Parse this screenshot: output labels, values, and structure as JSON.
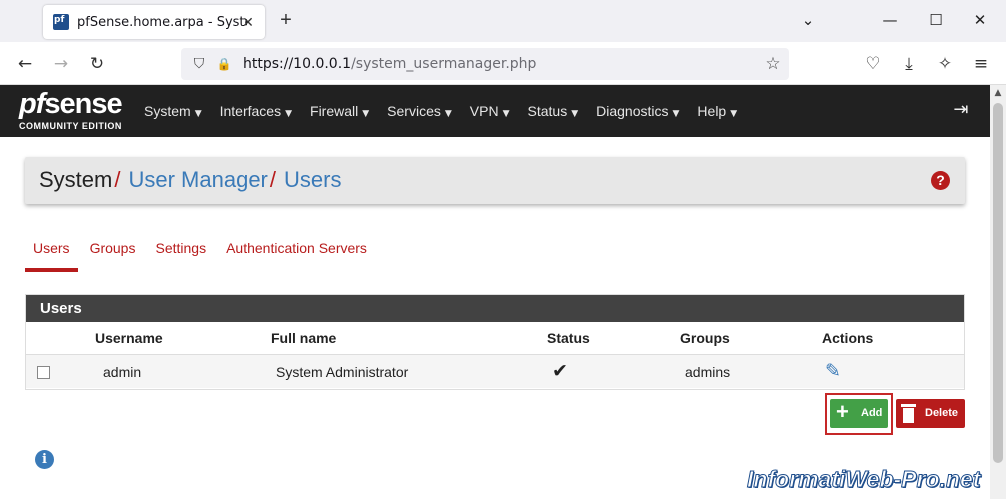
{
  "browser": {
    "tab_title": "pfSense.home.arpa - System: U",
    "tab_close": "✕",
    "new_tab": "+",
    "url_origin": "https://10.0.0.1",
    "url_path": "/system_usermanager.php",
    "icons": {
      "back": "←",
      "forward": "→",
      "reload": "↻",
      "shield": "⛉",
      "lock": "🔒",
      "star": "☆",
      "pocket": "♡",
      "download": "⤓",
      "extensions": "✧",
      "menu": "≡",
      "tabs_list": "⌄",
      "minimize": "—",
      "maximize": "☐",
      "close": "✕"
    }
  },
  "header": {
    "logo_pf": "pf",
    "logo_sense": "sense",
    "logo_sub": "COMMUNITY EDITION",
    "menu": [
      {
        "label": "System"
      },
      {
        "label": "Interfaces"
      },
      {
        "label": "Firewall"
      },
      {
        "label": "Services"
      },
      {
        "label": "VPN"
      },
      {
        "label": "Status"
      },
      {
        "label": "Diagnostics"
      },
      {
        "label": "Help"
      }
    ],
    "caret": "▼",
    "logout_icon": "⇥"
  },
  "breadcrumb": {
    "items": [
      "System",
      "User Manager",
      "Users"
    ],
    "separator": "/",
    "help": "?"
  },
  "tabs": [
    "Users",
    "Groups",
    "Settings",
    "Authentication Servers"
  ],
  "users_panel": {
    "title": "Users",
    "columns": [
      "Username",
      "Full name",
      "Status",
      "Groups",
      "Actions"
    ],
    "rows": [
      {
        "username": "admin",
        "full_name": "System Administrator",
        "status_icon": "✔",
        "groups": "admins",
        "edit_icon": "✎"
      }
    ]
  },
  "buttons": {
    "add": "Add",
    "add_icon": "+",
    "delete": "Delete"
  },
  "info": "i",
  "watermark": "InformatiWeb-Pro.net",
  "scroll_up": "▲"
}
